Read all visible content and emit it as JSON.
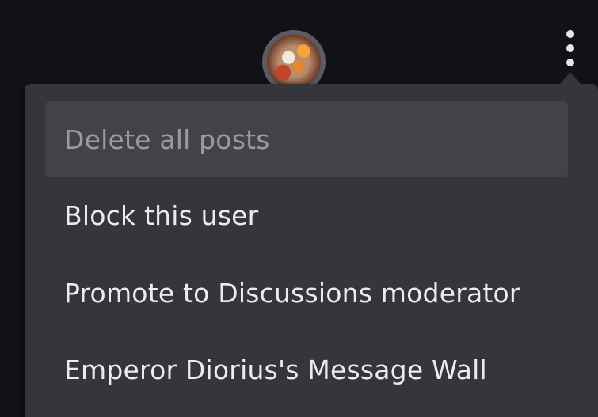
{
  "header": {
    "avatar_icon": "user-avatar",
    "more_options_icon": "kebab-vertical-icon"
  },
  "menu": {
    "items": [
      {
        "label": "Delete all posts",
        "disabled": true
      },
      {
        "label": "Block this user",
        "disabled": false
      },
      {
        "label": "Promote to Discussions moderator",
        "disabled": false
      },
      {
        "label": "Emperor Diorius's Message Wall",
        "disabled": false
      }
    ]
  },
  "colors": {
    "background": "#121216",
    "menu_background": "#35353a",
    "disabled_item_background": "#424247",
    "text": "#ececf0",
    "disabled_text": "#9a9aa0"
  }
}
